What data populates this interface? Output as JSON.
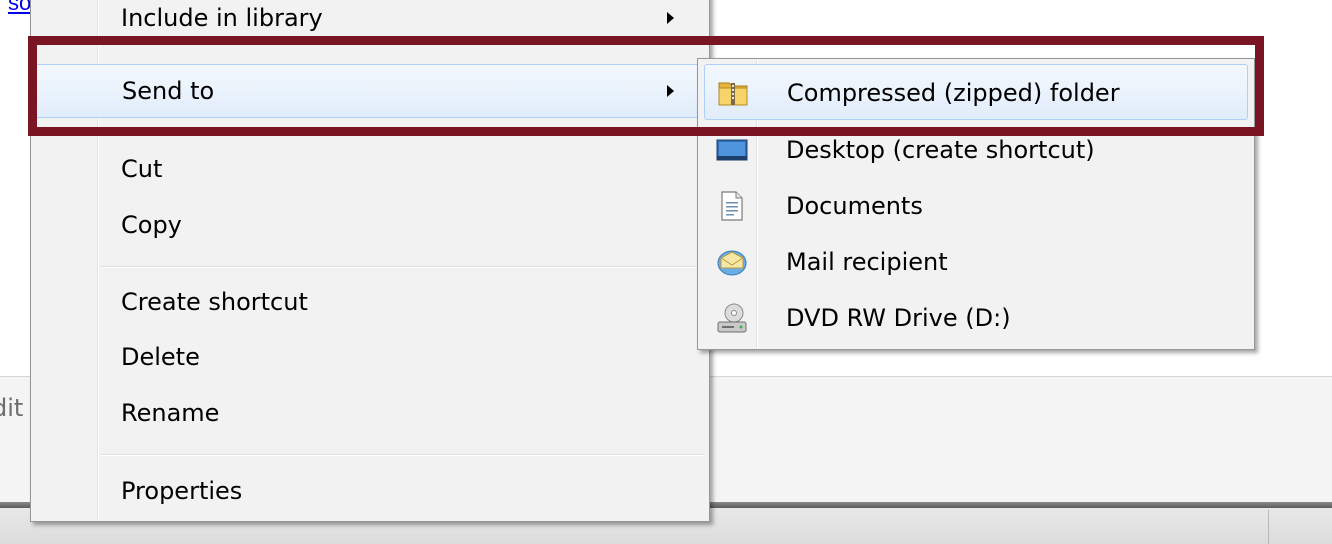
{
  "page": {
    "link_text": "soporte",
    "link_suffix": ".",
    "background_fragment": "dit"
  },
  "context_menu": {
    "items": [
      {
        "label": "Include in library",
        "has_submenu": true
      },
      {
        "label": "Send to",
        "has_submenu": true,
        "selected": true
      },
      {
        "label": "Cut"
      },
      {
        "label": "Copy"
      },
      {
        "label": "Create shortcut"
      },
      {
        "label": "Delete"
      },
      {
        "label": "Rename"
      },
      {
        "label": "Properties"
      }
    ]
  },
  "send_to_submenu": {
    "items": [
      {
        "label": "Compressed (zipped) folder",
        "icon": "zip-folder-icon",
        "selected": true
      },
      {
        "label": "Desktop (create shortcut)",
        "icon": "desktop-icon"
      },
      {
        "label": "Documents",
        "icon": "document-icon"
      },
      {
        "label": "Mail recipient",
        "icon": "mail-icon"
      },
      {
        "label": "DVD RW Drive (D:)",
        "icon": "dvd-drive-icon"
      }
    ]
  },
  "colors": {
    "highlight_frame": "#7a1523",
    "selection_border": "#aecff7",
    "link": "#0000ee"
  }
}
